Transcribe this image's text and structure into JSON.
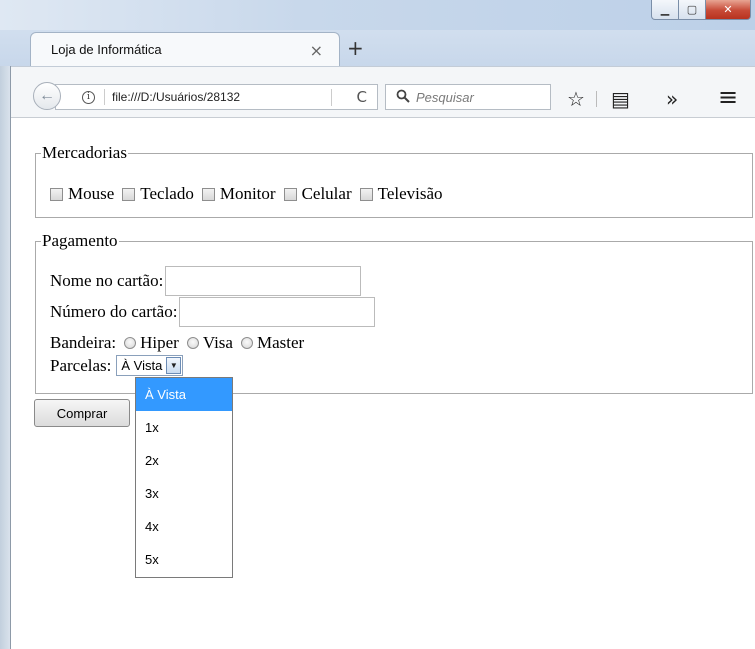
{
  "window": {
    "minimize_glyph": "▁",
    "maximize_glyph": "▢",
    "close_glyph": "✕"
  },
  "tab": {
    "title": "Loja de Informática",
    "close_glyph": "×",
    "new_tab_glyph": "+"
  },
  "nav": {
    "back_glyph": "←",
    "info_glyph": "i",
    "url": "file:///D:/Usuários/28132",
    "reload_glyph": "C",
    "search_glyph": "🔍",
    "search_placeholder": "Pesquisar",
    "bookmark_glyph": "☆",
    "reader_glyph": "▤",
    "overflow_glyph": "»",
    "menu_glyph": "≡"
  },
  "form": {
    "products_legend": "Mercadorias",
    "products": [
      "Mouse",
      "Teclado",
      "Monitor",
      "Celular",
      "Televisão"
    ],
    "payment_legend": "Pagamento",
    "card_name_label": "Nome no cartão:",
    "card_number_label": "Número do cartão:",
    "brand_label": "Bandeira:",
    "brands": [
      "Hiper",
      "Visa",
      "Master"
    ],
    "installments_label": "Parcelas:",
    "installments_selected": "À Vista",
    "installment_options": [
      "À Vista",
      "1x",
      "2x",
      "3x",
      "4x",
      "5x"
    ],
    "submit_label": "Comprar"
  }
}
